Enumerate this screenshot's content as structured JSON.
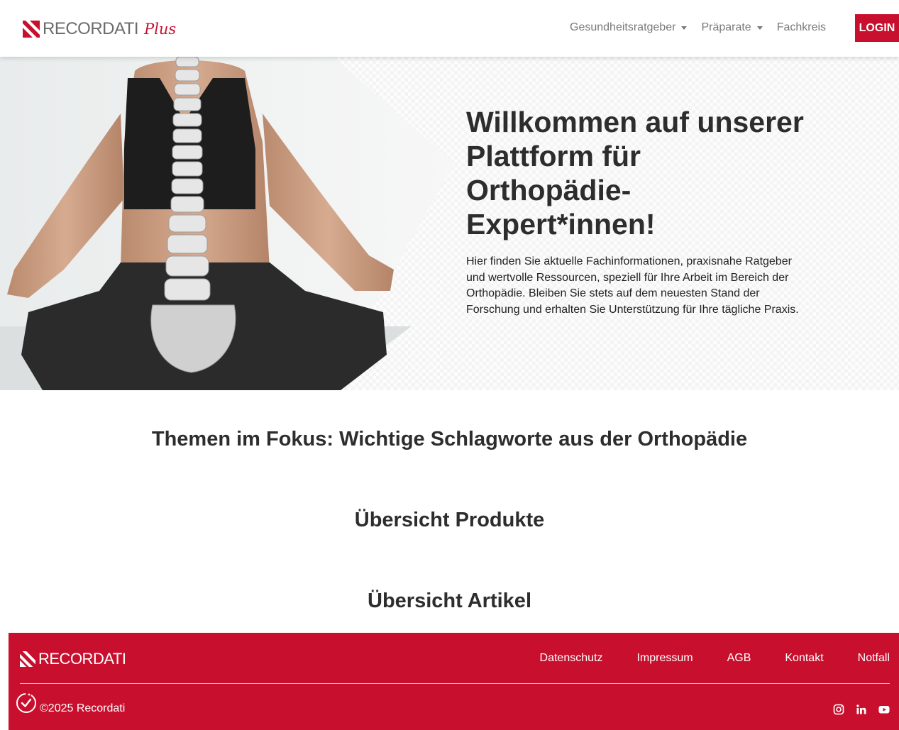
{
  "header": {
    "logo_text": "RECORDATI",
    "logo_plus": "Plus",
    "nav": [
      {
        "label": "Gesundheitsratgeber",
        "dropdown": true
      },
      {
        "label": "Präparate",
        "dropdown": true
      },
      {
        "label": "Fachkreis",
        "dropdown": false
      }
    ],
    "login_label": "LOGIN"
  },
  "hero": {
    "title": "Willkommen auf unserer Plattform für Orthopädie-Expert*innen!",
    "description": "Hier finden Sie aktuelle Fachinformationen, praxisnahe Ratgeber und wertvolle Ressourcen, speziell für Ihre Arbeit im Bereich der Orthopädie. Bleiben Sie stets auf dem neuesten Stand der Forschung und erhalten Sie Unterstützung für Ihre tägliche Praxis."
  },
  "sections": {
    "topics_title": "Themen im Fokus: Wichtige Schlagworte aus der Orthopädie",
    "products_title": "Übersicht Produkte",
    "articles_title": "Übersicht Artikel"
  },
  "footer": {
    "logo_text": "RECORDATI",
    "links": [
      "Datenschutz",
      "Impressum",
      "AGB",
      "Kontakt",
      "Notfall"
    ],
    "copyright": "©2025 Recordati",
    "social": [
      "instagram-icon",
      "linkedin-icon",
      "youtube-icon"
    ]
  },
  "colors": {
    "brand_red": "#c8102e",
    "text_dark": "#2d2d2d",
    "nav_gray": "#7a7a7a"
  }
}
